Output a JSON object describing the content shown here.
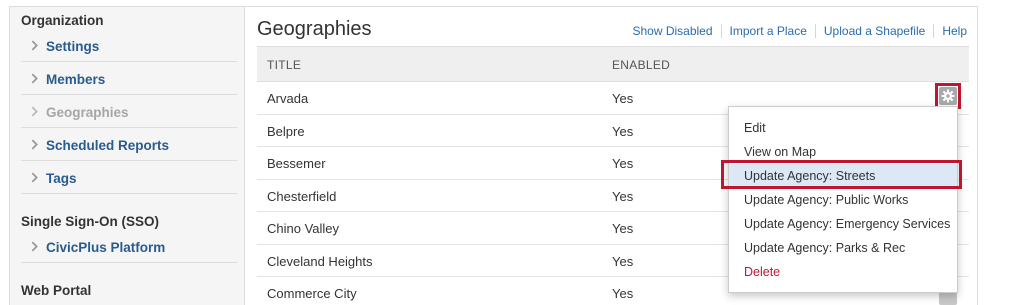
{
  "sidebar": {
    "sections": [
      {
        "heading": "Organization",
        "items": [
          {
            "label": "Settings"
          },
          {
            "label": "Members"
          },
          {
            "label": "Geographies"
          },
          {
            "label": "Scheduled Reports"
          },
          {
            "label": "Tags"
          }
        ]
      },
      {
        "heading": "Single Sign-On (SSO)",
        "items": [
          {
            "label": "CivicPlus Platform"
          }
        ]
      },
      {
        "heading": "Web Portal",
        "items": []
      }
    ]
  },
  "main": {
    "title": "Geographies",
    "links": [
      "Show Disabled",
      "Import a Place",
      "Upload a Shapefile",
      "Help"
    ],
    "table": {
      "columns": [
        "TITLE",
        "ENABLED"
      ],
      "rows": [
        {
          "title": "Arvada",
          "enabled": "Yes"
        },
        {
          "title": "Belpre",
          "enabled": "Yes"
        },
        {
          "title": "Bessemer",
          "enabled": "Yes"
        },
        {
          "title": "Chesterfield",
          "enabled": "Yes"
        },
        {
          "title": "Chino Valley",
          "enabled": "Yes"
        },
        {
          "title": "Cleveland Heights",
          "enabled": "Yes"
        },
        {
          "title": "Commerce City",
          "enabled": "Yes"
        }
      ]
    }
  },
  "menu": {
    "items": [
      "Edit",
      "View on Map",
      "Update Agency: Streets",
      "Update Agency: Public Works",
      "Update Agency: Emergency Services",
      "Update Agency: Parks & Rec",
      "Delete"
    ]
  },
  "icons": {
    "chevron": "chevron-right-icon",
    "gear": "gear-icon"
  },
  "colors": {
    "link": "#2a6bb0",
    "nav_label": "#2a5b8e",
    "highlight": "#c0152f",
    "selected_bg": "#dce8f6"
  }
}
